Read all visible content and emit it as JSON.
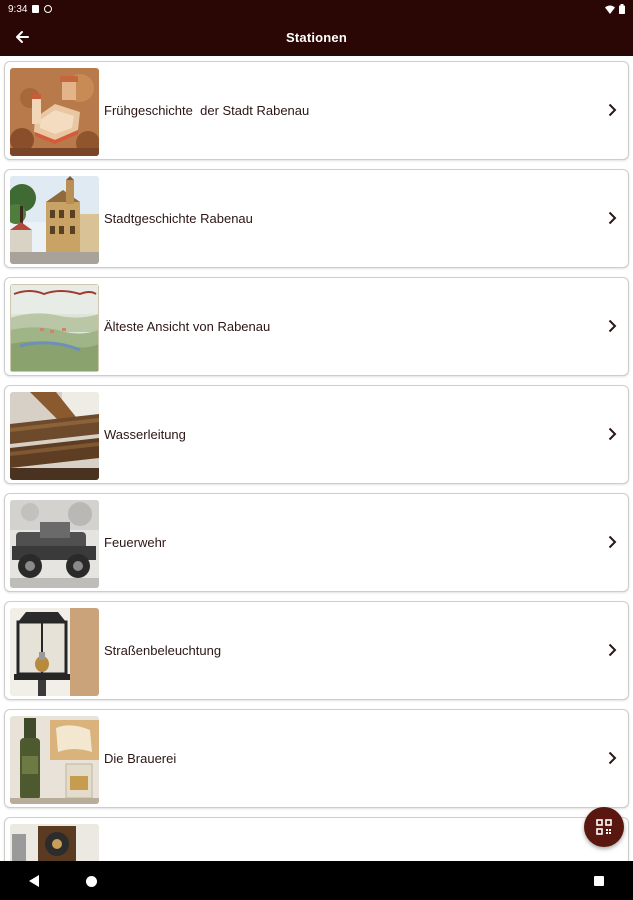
{
  "status_bar": {
    "time": "9:34"
  },
  "app_bar": {
    "title": "Stationen",
    "back_icon": "arrow-left-icon"
  },
  "stations": [
    {
      "label": "Frühgeschichte  der Stadt Rabenau",
      "thumb": "castle-model-photo"
    },
    {
      "label": "Stadtgeschichte Rabenau",
      "thumb": "town-hall-photo"
    },
    {
      "label": "Älteste Ansicht von Rabenau",
      "thumb": "old-painting-photo"
    },
    {
      "label": "Wasserleitung",
      "thumb": "wooden-pipes-photo"
    },
    {
      "label": "Feuerwehr",
      "thumb": "old-firetruck-photo"
    },
    {
      "label": "Straßenbeleuchtung",
      "thumb": "street-lantern-photo"
    },
    {
      "label": "Die Brauerei",
      "thumb": "beer-bottle-photo"
    },
    {
      "label": "",
      "thumb": "partial-photo"
    }
  ],
  "fab": {
    "icon": "qr-code-icon"
  },
  "colors": {
    "app_bar": "#2a0604",
    "fab": "#5a1710",
    "text": "#2b1716"
  }
}
